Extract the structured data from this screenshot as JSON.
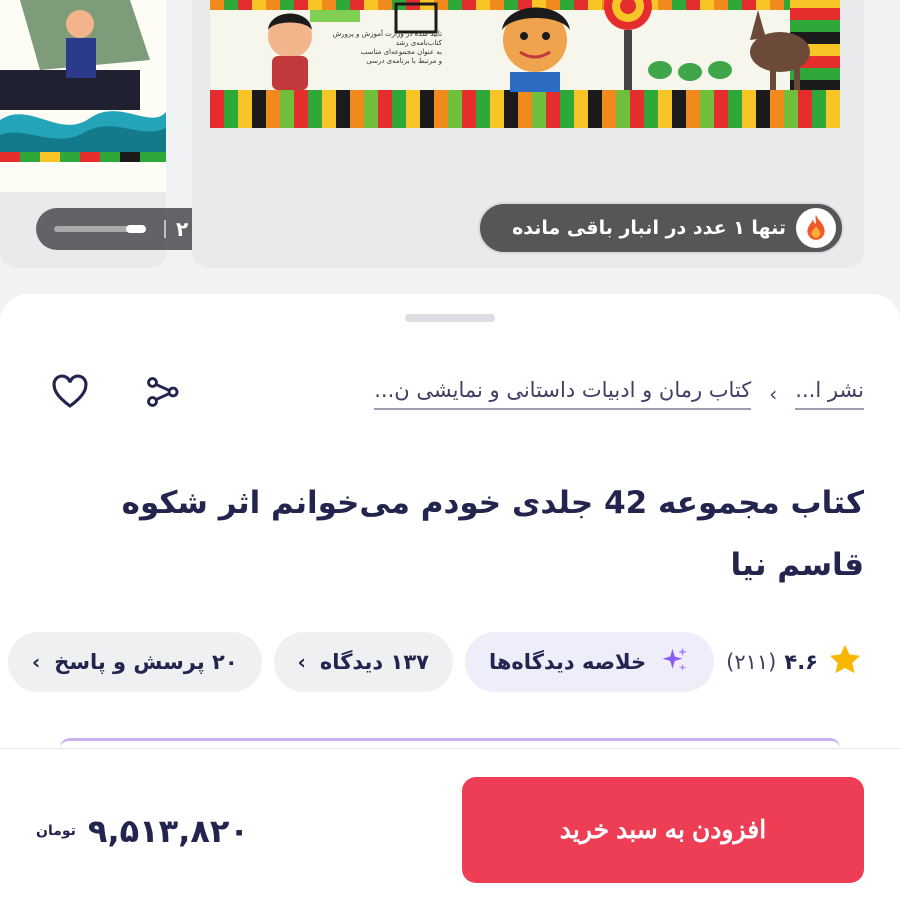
{
  "gallery": {
    "image_count": "۲",
    "stock_notice": "تنها ۱ عدد در انبار باقی مانده",
    "cover_text": [
      "تایید شده در وزارت آموزش و پرورش",
      "کتاب‌نامه‌ی رشد",
      "به عنوان مجموعه‌ای مناسب",
      "و مرتبط با برنامه‌ی درسی"
    ]
  },
  "breadcrumb": {
    "items": [
      "نشر ا...",
      "کتاب رمان و ادبیات داستانی و نمایشی ن..."
    ],
    "separator": "›"
  },
  "product": {
    "title": "کتاب مجموعه 42 جلدی خودم می‌خوانم اثر شکوه قاسم نیا",
    "rating": "۴.۶",
    "rating_count": "(۲۱۱)",
    "ai_summary_label": "خلاصه دیدگاه‌ها",
    "reviews_label": "۱۳۷ دیدگاه",
    "qa_label": "۲۰ پرسش و پاسخ"
  },
  "purchase": {
    "add_to_cart_label": "افزودن به سبد خرید",
    "price": "۹,۵۱۳,۸۲۰",
    "currency": "تومان"
  },
  "icons": {
    "share": "share-icon",
    "favorite": "heart-icon",
    "star": "star-icon",
    "sparkle": "sparkle-icon",
    "fire": "fire-icon",
    "image": "image-icon"
  },
  "colors": {
    "accent_red": "#ee3e55",
    "star_yellow": "#f9b700",
    "ai_purple": "#8a5cf5",
    "text_dark": "#23254e"
  }
}
